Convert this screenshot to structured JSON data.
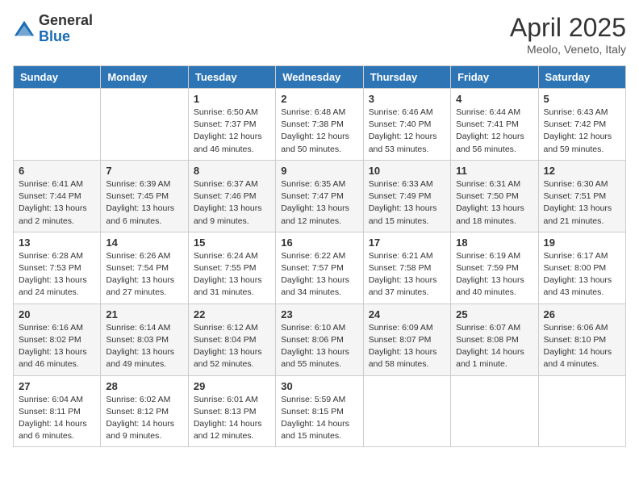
{
  "logo": {
    "general": "General",
    "blue": "Blue"
  },
  "title": "April 2025",
  "location": "Meolo, Veneto, Italy",
  "days": [
    "Sunday",
    "Monday",
    "Tuesday",
    "Wednesday",
    "Thursday",
    "Friday",
    "Saturday"
  ],
  "weeks": [
    [
      {
        "day": "",
        "detail": ""
      },
      {
        "day": "",
        "detail": ""
      },
      {
        "day": "1",
        "detail": "Sunrise: 6:50 AM\nSunset: 7:37 PM\nDaylight: 12 hours\nand 46 minutes."
      },
      {
        "day": "2",
        "detail": "Sunrise: 6:48 AM\nSunset: 7:38 PM\nDaylight: 12 hours\nand 50 minutes."
      },
      {
        "day": "3",
        "detail": "Sunrise: 6:46 AM\nSunset: 7:40 PM\nDaylight: 12 hours\nand 53 minutes."
      },
      {
        "day": "4",
        "detail": "Sunrise: 6:44 AM\nSunset: 7:41 PM\nDaylight: 12 hours\nand 56 minutes."
      },
      {
        "day": "5",
        "detail": "Sunrise: 6:43 AM\nSunset: 7:42 PM\nDaylight: 12 hours\nand 59 minutes."
      }
    ],
    [
      {
        "day": "6",
        "detail": "Sunrise: 6:41 AM\nSunset: 7:44 PM\nDaylight: 13 hours\nand 2 minutes."
      },
      {
        "day": "7",
        "detail": "Sunrise: 6:39 AM\nSunset: 7:45 PM\nDaylight: 13 hours\nand 6 minutes."
      },
      {
        "day": "8",
        "detail": "Sunrise: 6:37 AM\nSunset: 7:46 PM\nDaylight: 13 hours\nand 9 minutes."
      },
      {
        "day": "9",
        "detail": "Sunrise: 6:35 AM\nSunset: 7:47 PM\nDaylight: 13 hours\nand 12 minutes."
      },
      {
        "day": "10",
        "detail": "Sunrise: 6:33 AM\nSunset: 7:49 PM\nDaylight: 13 hours\nand 15 minutes."
      },
      {
        "day": "11",
        "detail": "Sunrise: 6:31 AM\nSunset: 7:50 PM\nDaylight: 13 hours\nand 18 minutes."
      },
      {
        "day": "12",
        "detail": "Sunrise: 6:30 AM\nSunset: 7:51 PM\nDaylight: 13 hours\nand 21 minutes."
      }
    ],
    [
      {
        "day": "13",
        "detail": "Sunrise: 6:28 AM\nSunset: 7:53 PM\nDaylight: 13 hours\nand 24 minutes."
      },
      {
        "day": "14",
        "detail": "Sunrise: 6:26 AM\nSunset: 7:54 PM\nDaylight: 13 hours\nand 27 minutes."
      },
      {
        "day": "15",
        "detail": "Sunrise: 6:24 AM\nSunset: 7:55 PM\nDaylight: 13 hours\nand 31 minutes."
      },
      {
        "day": "16",
        "detail": "Sunrise: 6:22 AM\nSunset: 7:57 PM\nDaylight: 13 hours\nand 34 minutes."
      },
      {
        "day": "17",
        "detail": "Sunrise: 6:21 AM\nSunset: 7:58 PM\nDaylight: 13 hours\nand 37 minutes."
      },
      {
        "day": "18",
        "detail": "Sunrise: 6:19 AM\nSunset: 7:59 PM\nDaylight: 13 hours\nand 40 minutes."
      },
      {
        "day": "19",
        "detail": "Sunrise: 6:17 AM\nSunset: 8:00 PM\nDaylight: 13 hours\nand 43 minutes."
      }
    ],
    [
      {
        "day": "20",
        "detail": "Sunrise: 6:16 AM\nSunset: 8:02 PM\nDaylight: 13 hours\nand 46 minutes."
      },
      {
        "day": "21",
        "detail": "Sunrise: 6:14 AM\nSunset: 8:03 PM\nDaylight: 13 hours\nand 49 minutes."
      },
      {
        "day": "22",
        "detail": "Sunrise: 6:12 AM\nSunset: 8:04 PM\nDaylight: 13 hours\nand 52 minutes."
      },
      {
        "day": "23",
        "detail": "Sunrise: 6:10 AM\nSunset: 8:06 PM\nDaylight: 13 hours\nand 55 minutes."
      },
      {
        "day": "24",
        "detail": "Sunrise: 6:09 AM\nSunset: 8:07 PM\nDaylight: 13 hours\nand 58 minutes."
      },
      {
        "day": "25",
        "detail": "Sunrise: 6:07 AM\nSunset: 8:08 PM\nDaylight: 14 hours\nand 1 minute."
      },
      {
        "day": "26",
        "detail": "Sunrise: 6:06 AM\nSunset: 8:10 PM\nDaylight: 14 hours\nand 4 minutes."
      }
    ],
    [
      {
        "day": "27",
        "detail": "Sunrise: 6:04 AM\nSunset: 8:11 PM\nDaylight: 14 hours\nand 6 minutes."
      },
      {
        "day": "28",
        "detail": "Sunrise: 6:02 AM\nSunset: 8:12 PM\nDaylight: 14 hours\nand 9 minutes."
      },
      {
        "day": "29",
        "detail": "Sunrise: 6:01 AM\nSunset: 8:13 PM\nDaylight: 14 hours\nand 12 minutes."
      },
      {
        "day": "30",
        "detail": "Sunrise: 5:59 AM\nSunset: 8:15 PM\nDaylight: 14 hours\nand 15 minutes."
      },
      {
        "day": "",
        "detail": ""
      },
      {
        "day": "",
        "detail": ""
      },
      {
        "day": "",
        "detail": ""
      }
    ]
  ]
}
